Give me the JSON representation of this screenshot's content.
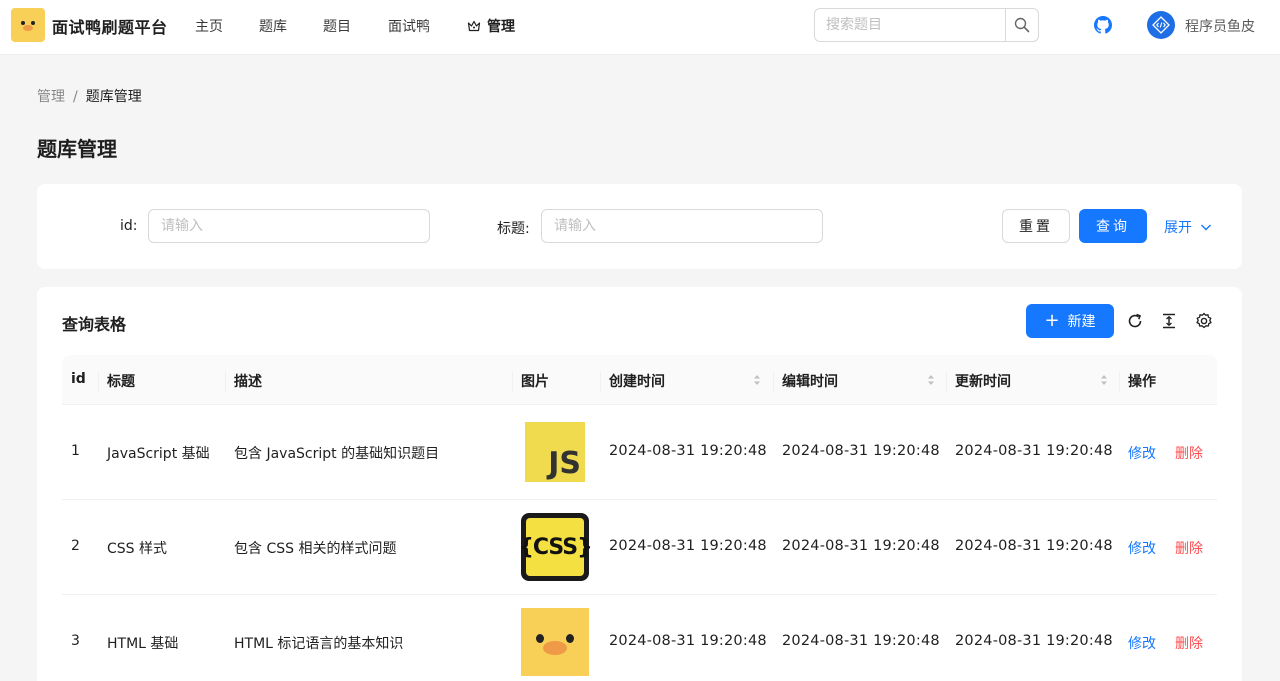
{
  "header": {
    "brand": "面试鸭刷题平台",
    "nav": [
      "主页",
      "题库",
      "题目",
      "面试鸭"
    ],
    "admin_label": "管理",
    "search_placeholder": "搜索题目",
    "username": "程序员鱼皮",
    "icons": {
      "logo": "duck-logo-icon",
      "search": "search-icon",
      "github": "github-icon",
      "crown": "crown-icon"
    }
  },
  "breadcrumb": {
    "parent": "管理",
    "separator": "/",
    "current": "题库管理"
  },
  "page_title": "题库管理",
  "filter": {
    "id_label": "id",
    "id_placeholder": "请输入",
    "title_label": "标题",
    "title_placeholder": "请输入",
    "colon": ":",
    "reset": "重置",
    "query": "查询",
    "expand": "展开"
  },
  "table": {
    "title": "查询表格",
    "new_button": "新建",
    "columns": [
      "id",
      "标题",
      "描述",
      "图片",
      "创建时间",
      "编辑时间",
      "更新时间",
      "操作"
    ],
    "rows": [
      {
        "id": "1",
        "title": "JavaScript 基础",
        "desc": "包含 JavaScript 的基础知识题目",
        "image_text": "JS",
        "created": "2024-08-31 19:20:48",
        "edited": "2024-08-31 19:20:48",
        "updated": "2024-08-31 19:20:48"
      },
      {
        "id": "2",
        "title": "CSS 样式",
        "desc": "包含 CSS 相关的样式问题",
        "image_text": "{CSS}",
        "created": "2024-08-31 19:20:48",
        "edited": "2024-08-31 19:20:48",
        "updated": "2024-08-31 19:20:48"
      },
      {
        "id": "3",
        "title": "HTML 基础",
        "desc": "HTML 标记语言的基本知识",
        "image_text": "",
        "created": "2024-08-31 19:20:48",
        "edited": "2024-08-31 19:20:48",
        "updated": "2024-08-31 19:20:48"
      }
    ],
    "actions": {
      "edit": "修改",
      "delete": "删除"
    }
  },
  "colors": {
    "primary": "#1677ff",
    "danger": "#ff4d4f",
    "logo_yellow": "#f8cf57"
  }
}
